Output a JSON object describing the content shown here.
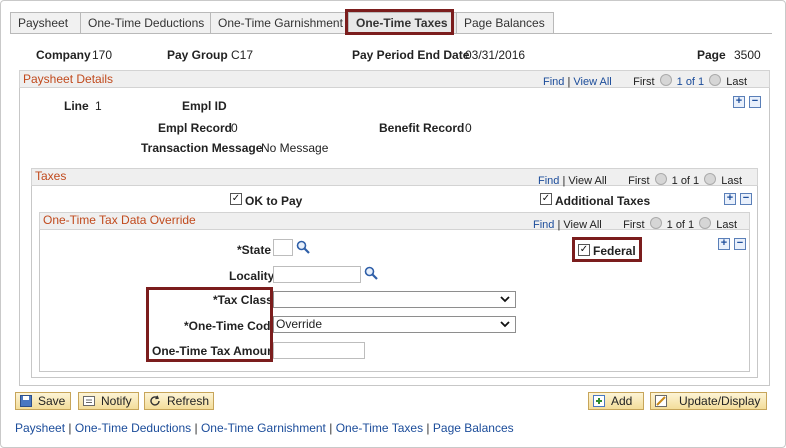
{
  "tabs": [
    {
      "label": "Paysheet"
    },
    {
      "label": "One-Time Deductions"
    },
    {
      "label": "One-Time Garnishment"
    },
    {
      "label": "One-Time Taxes"
    },
    {
      "label": "Page Balances"
    }
  ],
  "header": {
    "company_label": "Company",
    "company_value": "170",
    "paygroup_label": "Pay Group",
    "paygroup_value": "C17",
    "ppe_label": "Pay Period End Date",
    "ppe_value": "03/31/2016",
    "page_label": "Page",
    "page_value": "3500"
  },
  "paysheet": {
    "title": "Paysheet Details",
    "nav": {
      "find": "Find",
      "viewall": "View All",
      "first": "First",
      "count": "1 of 1",
      "last": "Last"
    },
    "line_label": "Line",
    "line_value": "1",
    "emplid_label": "Empl ID",
    "emplrec_label": "Empl Record",
    "emplrec_value": "0",
    "benefit_label": "Benefit Record",
    "benefit_value": "0",
    "txmsg_label": "Transaction Message",
    "txmsg_value": "No Message"
  },
  "taxes": {
    "title": "Taxes",
    "nav": {
      "find": "Find",
      "viewall": "View All",
      "first": "First",
      "count": "1 of 1",
      "last": "Last"
    },
    "ok_to_pay": "OK to Pay",
    "additional_taxes": "Additional Taxes"
  },
  "override": {
    "title": "One-Time Tax Data Override",
    "nav": {
      "find": "Find",
      "viewall": "View All",
      "first": "First",
      "count": "1 of 1",
      "last": "Last"
    },
    "state_label": "*State",
    "locality_label": "Locality",
    "federal_label": "Federal",
    "taxclass_label": "*Tax Class",
    "taxclass_value": "",
    "onetimecode_label": "*One-Time Code",
    "onetimecode_value": "Override",
    "amount_label": "One-Time Tax Amount"
  },
  "buttons": {
    "save": "Save",
    "notify": "Notify",
    "refresh": "Refresh",
    "add": "Add",
    "update": "Update/Display"
  },
  "bottom_links": [
    "Paysheet",
    "One-Time Deductions",
    "One-Time Garnishment",
    "One-Time Taxes",
    "Page Balances"
  ]
}
